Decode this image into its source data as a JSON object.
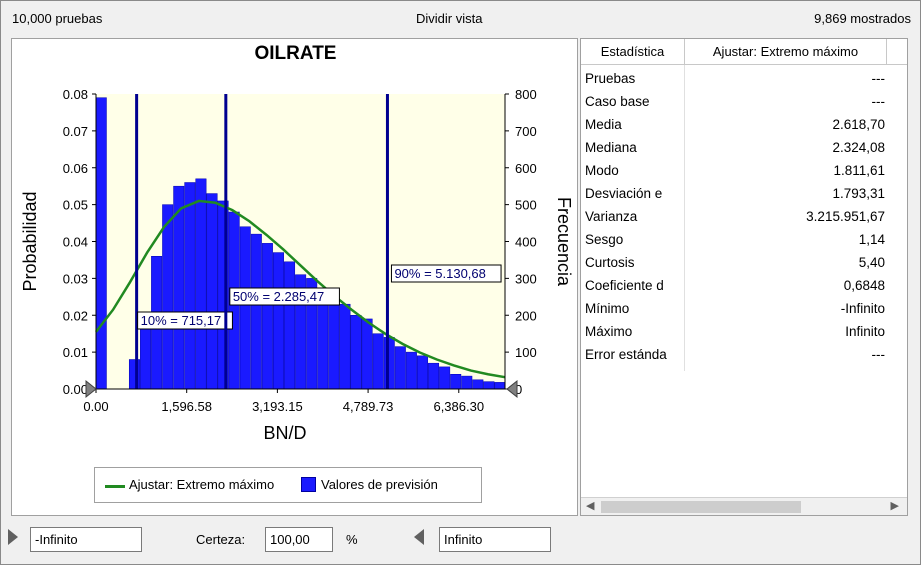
{
  "top": {
    "trials": "10,000 pruebas",
    "split_view": "Dividir vista",
    "shown": "9,869 mostrados"
  },
  "chart_data": {
    "type": "bar",
    "title": "OILRATE",
    "xlabel": "BN/D",
    "ylabel_left": "Probabilidad",
    "ylabel_right": "Frecuencia",
    "x_ticks": [
      "0.00",
      "1,596.58",
      "3,193.15",
      "4,789.73",
      "6,386.30"
    ],
    "x_tick_values": [
      0,
      1596.58,
      3193.15,
      4789.73,
      6386.3
    ],
    "y_left_ticks": [
      "0.00",
      "0.01",
      "0.02",
      "0.03",
      "0.04",
      "0.05",
      "0.06",
      "0.07",
      "0.08"
    ],
    "y_right_ticks": [
      "0",
      "100",
      "200",
      "300",
      "400",
      "500",
      "600",
      "700",
      "800"
    ],
    "ylim": [
      0,
      0.08
    ],
    "bin_width": 195,
    "bin_starts": [
      0,
      195,
      390,
      585,
      780,
      975,
      1170,
      1365,
      1560,
      1755,
      1950,
      2145,
      2340,
      2535,
      2730,
      2925,
      3120,
      3315,
      3510,
      3705,
      3900,
      4095,
      4290,
      4485,
      4680,
      4875,
      5070,
      5265,
      5460,
      5655,
      5850,
      6045,
      6240,
      6435,
      6630,
      6825,
      7020
    ],
    "values": [
      0.079,
      0,
      0,
      0.008,
      0.02,
      0.036,
      0.05,
      0.055,
      0.056,
      0.057,
      0.053,
      0.051,
      0.048,
      0.044,
      0.042,
      0.0395,
      0.037,
      0.0345,
      0.031,
      0.03,
      0.027,
      0.025,
      0.023,
      0.02,
      0.019,
      0.015,
      0.014,
      0.0115,
      0.01,
      0.009,
      0.007,
      0.006,
      0.004,
      0.0035,
      0.0025,
      0.002,
      0.0018
    ],
    "fit_curve": {
      "name": "Ajustar: Extremo máximo",
      "x": [
        0,
        300,
        600,
        900,
        1200,
        1500,
        1811.61,
        2100,
        2400,
        2700,
        3000,
        3300,
        3600,
        3900,
        4200,
        4500,
        4800,
        5100,
        5400,
        5700,
        6000,
        6300,
        6600,
        6900,
        7200
      ],
      "y": [
        0.0155,
        0.0215,
        0.029,
        0.037,
        0.044,
        0.049,
        0.051,
        0.0505,
        0.0485,
        0.0455,
        0.0418,
        0.0378,
        0.0335,
        0.0292,
        0.0252,
        0.0215,
        0.018,
        0.0149,
        0.0122,
        0.0099,
        0.008,
        0.0064,
        0.005,
        0.004,
        0.0032
      ]
    },
    "percentile_lines": [
      {
        "x": 715.17,
        "label": "10% = 715,17"
      },
      {
        "x": 2285.47,
        "label": "50% = 2.285,47"
      },
      {
        "x": 5130.68,
        "label": "90% = 5.130,68"
      }
    ],
    "legend": [
      {
        "label": "Ajustar: Extremo máximo",
        "color": "#218a21"
      },
      {
        "label": "Valores de previsión",
        "color": "#1a1aff"
      }
    ],
    "bar_color": "#1a1aff",
    "plot_bg": "#ffffe8",
    "grid": false
  },
  "stats": {
    "header": [
      "Estadística",
      "Ajustar: Extremo máximo"
    ],
    "rows": [
      {
        "label": "Pruebas",
        "value": "---"
      },
      {
        "label": "Caso base",
        "value": "---"
      },
      {
        "label": "Media",
        "value": "2.618,70"
      },
      {
        "label": "Mediana",
        "value": "2.324,08"
      },
      {
        "label": "Modo",
        "value": "1.811,61"
      },
      {
        "label": "Desviación e",
        "value": "1.793,31"
      },
      {
        "label": "Varianza",
        "value": "3.215.951,67"
      },
      {
        "label": "Sesgo",
        "value": "1,14"
      },
      {
        "label": "Curtosis",
        "value": "5,40"
      },
      {
        "label": "Coeficiente d",
        "value": "0,6848"
      },
      {
        "label": "Mínimo",
        "value": "-Infinito"
      },
      {
        "label": "Máximo",
        "value": "Infinito"
      },
      {
        "label": "Error estánda",
        "value": "---"
      }
    ]
  },
  "bottom": {
    "left_value": "-Infinito",
    "certainty_label": "Certeza:",
    "certainty_value": "100,00",
    "percent_sign": "%",
    "right_value": "Infinito"
  }
}
